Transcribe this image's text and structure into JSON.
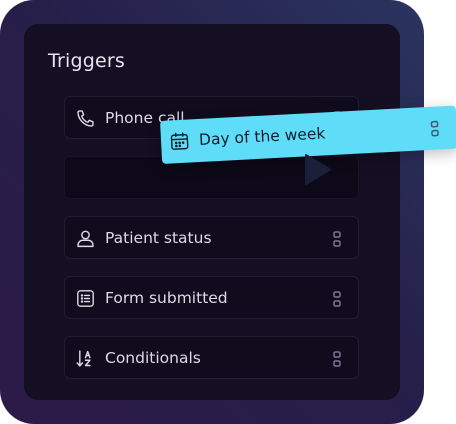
{
  "panel": {
    "title": "Triggers"
  },
  "triggers": [
    {
      "label": "Phone call",
      "icon": "phone-icon"
    },
    {
      "label": "Patient status",
      "icon": "user-icon"
    },
    {
      "label": "Form submitted",
      "icon": "list-icon"
    },
    {
      "label": "Conditionals",
      "icon": "sort-az-icon"
    }
  ],
  "dragging": {
    "label": "Day of the week",
    "icon": "calendar-icon"
  },
  "colors": {
    "panel_background": "#140f22",
    "drag_accent": "#5fdcf7",
    "text": "#dddbe6"
  }
}
